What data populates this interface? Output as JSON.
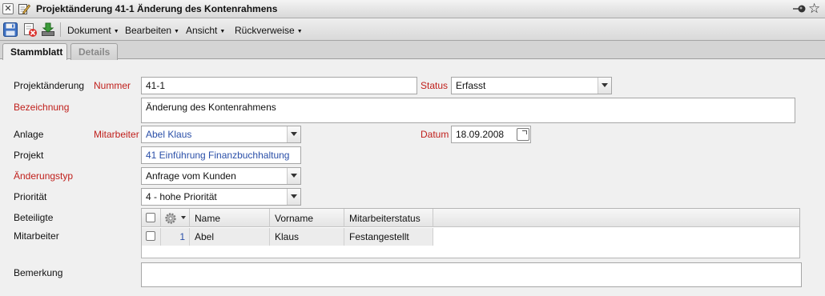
{
  "window": {
    "title": "Projektänderung 41-1 Änderung des Kontenrahmens",
    "close_symbol": "✕",
    "star_symbol": "☆",
    "icons": [
      "close-icon",
      "document-edit-icon",
      "pin-icon",
      "star-icon"
    ]
  },
  "toolbar": {
    "buttons": [
      "save-icon",
      "delete-icon",
      "download-icon"
    ],
    "menus": [
      {
        "label": "Dokument"
      },
      {
        "label": "Bearbeiten"
      },
      {
        "label": "Ansicht"
      },
      {
        "label": "Rückverweise"
      }
    ],
    "menu_arrow": "▼"
  },
  "tabs": [
    {
      "label": "Stammblatt",
      "active": true
    },
    {
      "label": "Details",
      "active": false
    }
  ],
  "form": {
    "projektaenderung_label": "Projektänderung",
    "nummer_label": "Nummer",
    "nummer_value": "41-1",
    "status_label": "Status",
    "status_value": "Erfasst",
    "bezeichnung_label": "Bezeichnung",
    "bezeichnung_value": "Änderung des Kontenrahmens",
    "anlage_label": "Anlage",
    "mitarbeiter_label": "Mitarbeiter",
    "mitarbeiter_value": "Abel Klaus",
    "datum_label": "Datum",
    "datum_value": "18.09.2008",
    "projekt_label": "Projekt",
    "projekt_value": "41 Einführung Finanzbuchhaltung",
    "aenderungstyp_label": "Änderungstyp",
    "aenderungstyp_value": "Anfrage vom Kunden",
    "prioritaet_label": "Priorität",
    "prioritaet_value": "4 - hohe Priorität",
    "beteiligte_label": "Beteiligte",
    "beteiligte_label2": "Mitarbeiter",
    "bemerkung_label": "Bemerkung",
    "bemerkung_value": ""
  },
  "grid": {
    "columns": [
      "Name",
      "Vorname",
      "Mitarbeiterstatus"
    ],
    "rows": [
      {
        "index": "1",
        "name": "Abel",
        "vorname": "Klaus",
        "status": "Festangestellt"
      }
    ]
  },
  "colors": {
    "required_label": "#c0201c",
    "link_text": "#2a4fa8"
  }
}
